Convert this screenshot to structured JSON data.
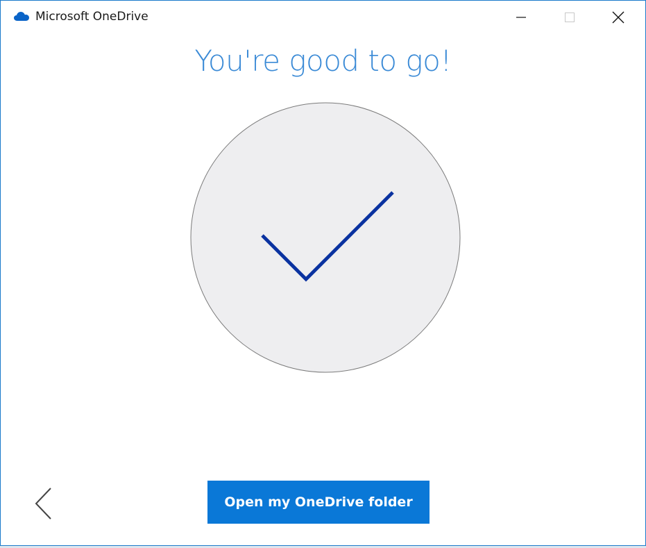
{
  "window": {
    "title": "Microsoft OneDrive",
    "app_icon": "onedrive-cloud-icon",
    "controls": {
      "minimize_icon": "minimize-icon",
      "maximize_icon": "maximize-icon",
      "close_icon": "close-icon"
    }
  },
  "main": {
    "heading": "You're good to go!",
    "status_icon": "checkmark-icon"
  },
  "footer": {
    "back_icon": "chevron-left-icon",
    "primary_button_label": "Open my OneDrive folder"
  },
  "colors": {
    "accent": "#0a78d7",
    "heading": "#3a8ad6",
    "checkmark": "#0a32a0",
    "circle_fill": "#eeeef0",
    "window_border": "#1979ca"
  }
}
